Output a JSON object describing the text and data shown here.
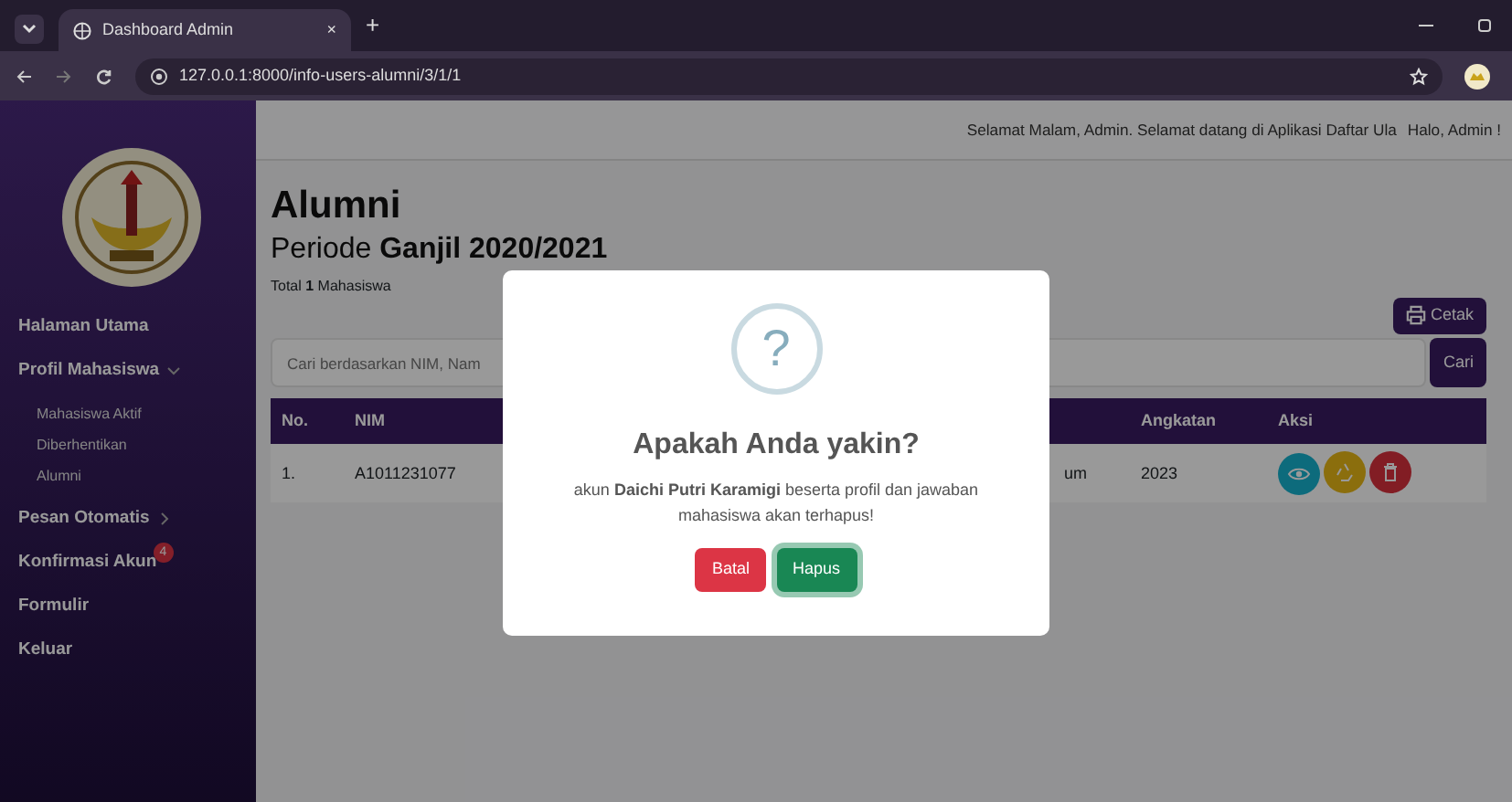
{
  "browser": {
    "tab_title": "Dashboard Admin",
    "tab_close": "×",
    "new_tab": "+",
    "url": "127.0.0.1:8000/info-users-alumni/3/1/1"
  },
  "header": {
    "greeting": "Selamat Malam, Admin. Selamat datang di Aplikasi Daftar Ula",
    "hello": "Halo, Admin !"
  },
  "sidebar": {
    "items": [
      {
        "label": "Halaman Utama",
        "kind": "link"
      },
      {
        "label": "Profil Mahasiswa",
        "kind": "group",
        "expanded": true,
        "children": [
          {
            "label": "Mahasiswa Aktif"
          },
          {
            "label": "Diberhentikan"
          },
          {
            "label": "Alumni"
          }
        ]
      },
      {
        "label": "Pesan Otomatis",
        "kind": "group",
        "expanded": false
      },
      {
        "label": "Konfirmasi Akun",
        "kind": "link",
        "badge": "4"
      },
      {
        "label": "Formulir",
        "kind": "link"
      },
      {
        "label": "Keluar",
        "kind": "link"
      }
    ]
  },
  "page": {
    "title": "Alumni",
    "period_prefix": "Periode",
    "period": "Ganjil 2020/2021",
    "total": "Total **1** Mahasiswa",
    "print_button": "Cetak",
    "search": {
      "placeholder": "Cari berdasarkan NIM, Nam",
      "button": "Cari"
    }
  },
  "table": {
    "columns": [
      "No.",
      "NIM",
      "",
      "",
      "Angkatan",
      "Aksi"
    ],
    "rows": [
      {
        "cells": [
          "1.",
          "A1011231077",
          "",
          "um",
          "2023"
        ]
      }
    ]
  },
  "dialog": {
    "icon": "?",
    "title": "Apakah Anda yakin?",
    "message": "akun **Daichi Putri Karamigi** beserta profil dan jawaban mahasiswa akan terhapus!",
    "buttons": [
      {
        "label": "Batal",
        "kind": "cancel",
        "selected": false
      },
      {
        "label": "Hapus",
        "kind": "confirm",
        "selected": true
      }
    ]
  }
}
